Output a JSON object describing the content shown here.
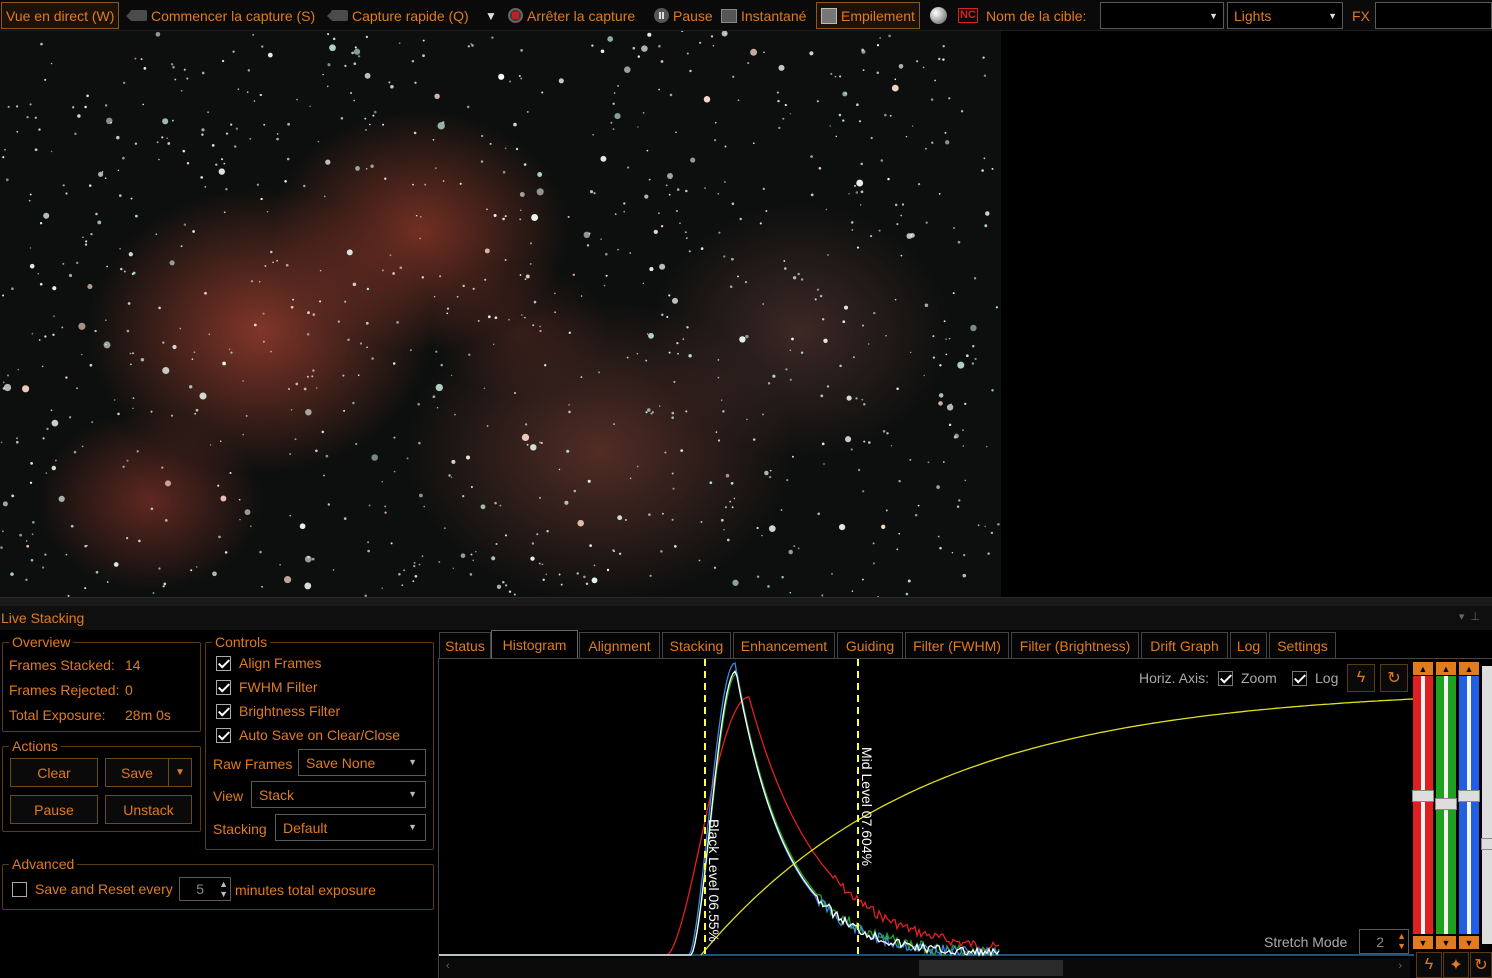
{
  "toolbar": {
    "live_view": "Vue en direct (W)",
    "start_capture": "Commencer la capture (S)",
    "quick_capture": "Capture rapide (Q)",
    "stop_capture": "Arrêter la capture",
    "pause": "Pause",
    "snapshot": "Instantané",
    "stacking": "Empilement",
    "nc_label": "NC",
    "target_label": "Nom de la cible:",
    "target_value": "",
    "frame_type": "Lights",
    "fx_label": "FX",
    "fx_value": ""
  },
  "dock": {
    "title": "Live Stacking",
    "overview": {
      "legend": "Overview",
      "frames_stacked_label": "Frames Stacked:",
      "frames_stacked_value": "14",
      "frames_rejected_label": "Frames Rejected:",
      "frames_rejected_value": "0",
      "total_exposure_label": "Total Exposure:",
      "total_exposure_value": "28m 0s"
    },
    "actions": {
      "legend": "Actions",
      "clear": "Clear",
      "save": "Save",
      "pause": "Pause",
      "unstack": "Unstack"
    },
    "controls": {
      "legend": "Controls",
      "align_frames": "Align Frames",
      "fwhm_filter": "FWHM Filter",
      "brightness_filter": "Brightness Filter",
      "auto_save": "Auto Save on Clear/Close",
      "raw_frames_label": "Raw Frames",
      "raw_frames_value": "Save None",
      "view_label": "View",
      "view_value": "Stack",
      "stacking_label": "Stacking",
      "stacking_value": "Default"
    },
    "advanced": {
      "legend": "Advanced",
      "save_reset_label": "Save and Reset every",
      "save_reset_value": "5",
      "save_reset_suffix": "minutes total exposure"
    }
  },
  "tabs": [
    {
      "label": "Status"
    },
    {
      "label": "Histogram"
    },
    {
      "label": "Alignment"
    },
    {
      "label": "Stacking"
    },
    {
      "label": "Enhancement"
    },
    {
      "label": "Guiding"
    },
    {
      "label": "Filter (FWHM)"
    },
    {
      "label": "Filter (Brightness)"
    },
    {
      "label": "Drift Graph"
    },
    {
      "label": "Log"
    },
    {
      "label": "Settings"
    }
  ],
  "histogram": {
    "horiz_axis_label": "Horiz. Axis:",
    "zoom_label": "Zoom",
    "log_label": "Log",
    "black_level_label": "Black Level  06.55%",
    "mid_level_label": "Mid Level  07.604%",
    "stretch_mode_label": "Stretch Mode",
    "stretch_mode_value": "2",
    "colors": {
      "red": "#e02020",
      "green": "#20a020",
      "blue": "#3a8ae0",
      "white": "#ffffff",
      "curve": "#e0e020",
      "marker": "#ffff40"
    }
  }
}
